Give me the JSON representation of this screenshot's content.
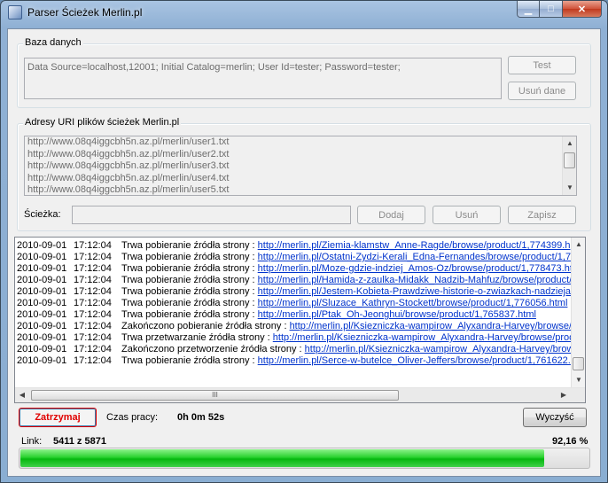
{
  "window": {
    "title": "Parser Ścieżek Merlin.pl",
    "min_glyph": "▁",
    "max_glyph": "□",
    "close_glyph": "✕"
  },
  "database": {
    "legend": "Baza danych",
    "connection_string": "Data Source=localhost,12001; Initial Catalog=merlin; User Id=tester; Password=tester;",
    "test_label": "Test",
    "delete_data_label": "Usuń dane"
  },
  "uris": {
    "legend": "Adresy URI plików ścieżek Merlin.pl",
    "items": [
      "http://www.08q4iggcbh5n.az.pl/merlin/user1.txt",
      "http://www.08q4iggcbh5n.az.pl/merlin/user2.txt",
      "http://www.08q4iggcbh5n.az.pl/merlin/user3.txt",
      "http://www.08q4iggcbh5n.az.pl/merlin/user4.txt",
      "http://www.08q4iggcbh5n.az.pl/merlin/user5.txt"
    ],
    "path_label": "Ścieżka:",
    "path_value": "",
    "add_label": "Dodaj",
    "remove_label": "Usuń",
    "save_label": "Zapisz"
  },
  "log": {
    "rows": [
      {
        "date": "2010-09-01",
        "time": "17:12:04",
        "msg": "Trwa pobieranie źródła strony : ",
        "link": "http://merlin.pl/Ziemia-klamstw_Anne-Ragde/browse/product/1,774399.h"
      },
      {
        "date": "2010-09-01",
        "time": "17:12:04",
        "msg": "Trwa pobieranie źródła strony : ",
        "link": "http://merlin.pl/Ostatni-Zydzi-Kerali_Edna-Fernandes/browse/product/1,774"
      },
      {
        "date": "2010-09-01",
        "time": "17:12:04",
        "msg": "Trwa pobieranie źródła strony : ",
        "link": "http://merlin.pl/Moze-gdzie-indziej_Amos-Oz/browse/product/1,778473.htr"
      },
      {
        "date": "2010-09-01",
        "time": "17:12:04",
        "msg": "Trwa pobieranie źródła strony : ",
        "link": "http://merlin.pl/Hamida-z-zaulka-Midakk_Nadzib-Mahfuz/browse/product/"
      },
      {
        "date": "2010-09-01",
        "time": "17:12:04",
        "msg": "Trwa pobieranie źródła strony : ",
        "link": "http://merlin.pl/Jestem-Kobieta-Prawdziwe-historie-o-zwiazkach-nadziejach"
      },
      {
        "date": "2010-09-01",
        "time": "17:12:04",
        "msg": "Trwa pobieranie źródła strony : ",
        "link": "http://merlin.pl/Sluzace_Kathryn-Stockett/browse/product/1,776056.html"
      },
      {
        "date": "2010-09-01",
        "time": "17:12:04",
        "msg": "Trwa pobieranie źródła strony : ",
        "link": "http://merlin.pl/Ptak_Oh-Jeonghui/browse/product/1,765837.html"
      },
      {
        "date": "2010-09-01",
        "time": "17:12:04",
        "msg": "Zakończono pobieranie źródła strony : ",
        "link": "http://merlin.pl/Ksiezniczka-wampirow_Alyxandra-Harvey/browse/p"
      },
      {
        "date": "2010-09-01",
        "time": "17:12:04",
        "msg": "Trwa przetwarzanie źródła strony : ",
        "link": "http://merlin.pl/Ksiezniczka-wampirow_Alyxandra-Harvey/browse/prod"
      },
      {
        "date": "2010-09-01",
        "time": "17:12:04",
        "msg": "Zakończono przetworzenie źródła strony : ",
        "link": "http://merlin.pl/Ksiezniczka-wampirow_Alyxandra-Harvey/brow"
      },
      {
        "date": "2010-09-01",
        "time": "17:12:04",
        "msg": "Trwa pobieranie źródła strony : ",
        "link": "http://merlin.pl/Serce-w-butelce_Oliver-Jeffers/browse/product/1,761622."
      }
    ],
    "hscroll_grip": "III"
  },
  "controls": {
    "stop_label": "Zatrzymaj",
    "work_time_label": "Czas pracy:",
    "work_time_value": "0h 0m 52s",
    "clear_label": "Wyczyść",
    "link_label": "Link:",
    "link_count": "5411 z 5871",
    "percent_text": "92,16 %",
    "progress_fraction": 0.9216
  },
  "colors": {
    "accent_red": "#e00000",
    "link_blue": "#0033cc",
    "progress_green": "#06b80f"
  }
}
